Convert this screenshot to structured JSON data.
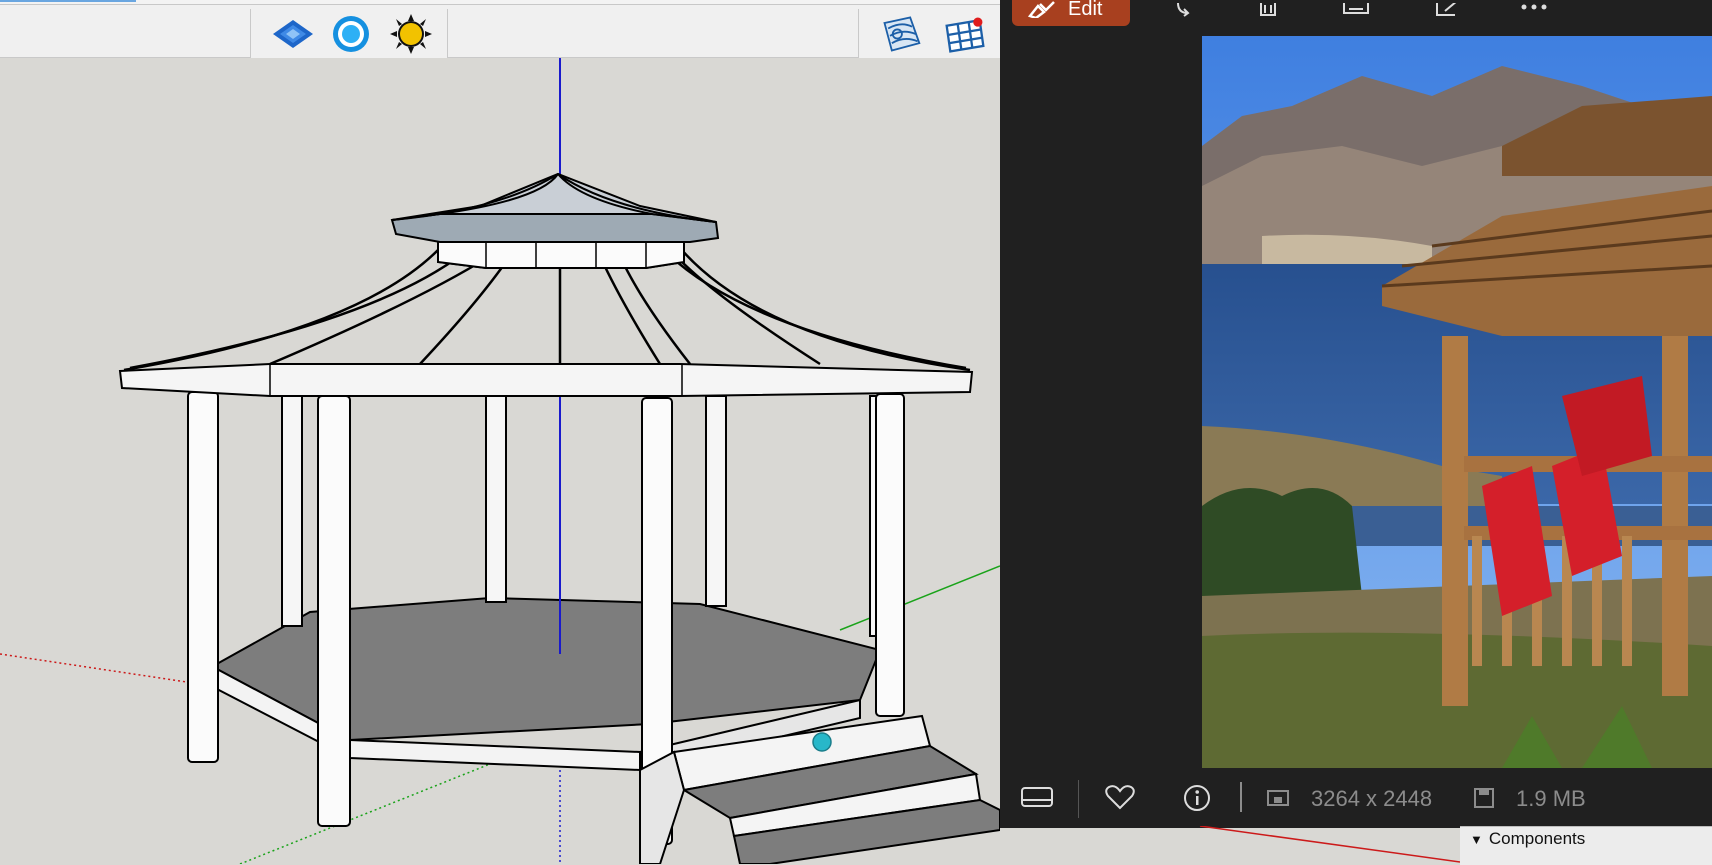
{
  "sketchup": {
    "toolbar_icons": [
      {
        "name": "layers-icon"
      },
      {
        "name": "styles-icon"
      },
      {
        "name": "shadows-icon"
      },
      {
        "name": "sandbox-icon"
      },
      {
        "name": "grid-icon"
      }
    ],
    "colors": {
      "viewport_bg": "#d9d8d4",
      "axis_blue": "#1a1acc",
      "axis_green": "#1aa31a",
      "axis_red": "#cc1a1a",
      "floor": "#7d7d7d",
      "roof_edge": "#9eaab4"
    }
  },
  "photos": {
    "toolbar": {
      "edit_label": "Edit",
      "icons": [
        "rotate-icon",
        "delete-icon",
        "print-icon",
        "share-icon",
        "more-icon"
      ]
    },
    "status": {
      "dimensions": "3264 x 2448",
      "filesize": "1.9 MB",
      "icons": [
        "filmstrip-icon",
        "favorite-icon",
        "info-icon",
        "dimensions-icon",
        "filesize-icon"
      ]
    },
    "colors": {
      "background": "#202020",
      "edit_accent": "#a8401f",
      "status_text": "#8c8c8c"
    }
  },
  "components": {
    "title": "Components"
  }
}
